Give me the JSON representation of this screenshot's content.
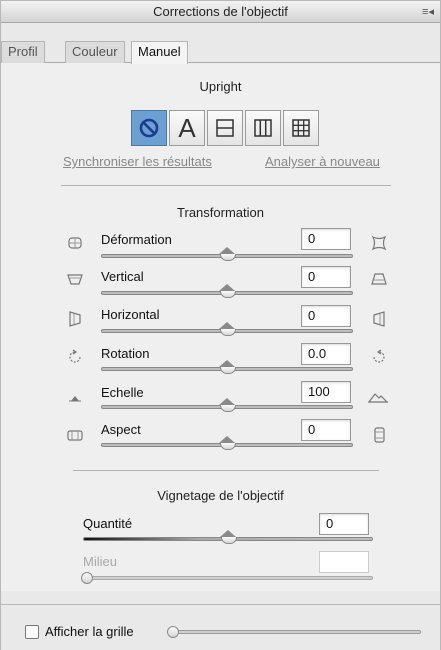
{
  "window": {
    "title": "Corrections de l'objectif"
  },
  "tabs": [
    {
      "label": "Profil"
    },
    {
      "label": "Couleur"
    },
    {
      "label": "Manuel"
    }
  ],
  "upright": {
    "title": "Upright",
    "buttons": [
      {
        "icon": "off-icon",
        "active": true
      },
      {
        "label": "A",
        "active": false
      },
      {
        "icon": "level-icon",
        "active": false
      },
      {
        "icon": "vertical-icon",
        "active": false
      },
      {
        "icon": "full-grid-icon",
        "active": false
      }
    ],
    "sync_link": "Synchroniser les résultats",
    "reanalyze_link": "Analyser à nouveau"
  },
  "transformation": {
    "title": "Transformation",
    "controls": [
      {
        "label": "Déformation",
        "value": "0",
        "slider_fraction": 0.5
      },
      {
        "label": "Vertical",
        "value": "0",
        "slider_fraction": 0.5
      },
      {
        "label": "Horizontal",
        "value": "0",
        "slider_fraction": 0.5
      },
      {
        "label": "Rotation",
        "value": "0.0",
        "slider_fraction": 0.5
      },
      {
        "label": "Echelle",
        "value": "100",
        "slider_fraction": 0.5
      },
      {
        "label": "Aspect",
        "value": "0",
        "slider_fraction": 0.5
      }
    ]
  },
  "vignetting": {
    "title": "Vignetage de l'objectif",
    "quantity_label": "Quantité",
    "quantity_value": "0",
    "quantity_fraction": 0.5,
    "midpoint_label": "Milieu",
    "midpoint_value": "",
    "midpoint_fraction": 0.0
  },
  "footer": {
    "grid_label": "Afficher la grille",
    "grid_checked": false,
    "grid_fraction": 0.0
  },
  "colors": {
    "accent": "#6c9fd2",
    "background": "#efefef"
  }
}
